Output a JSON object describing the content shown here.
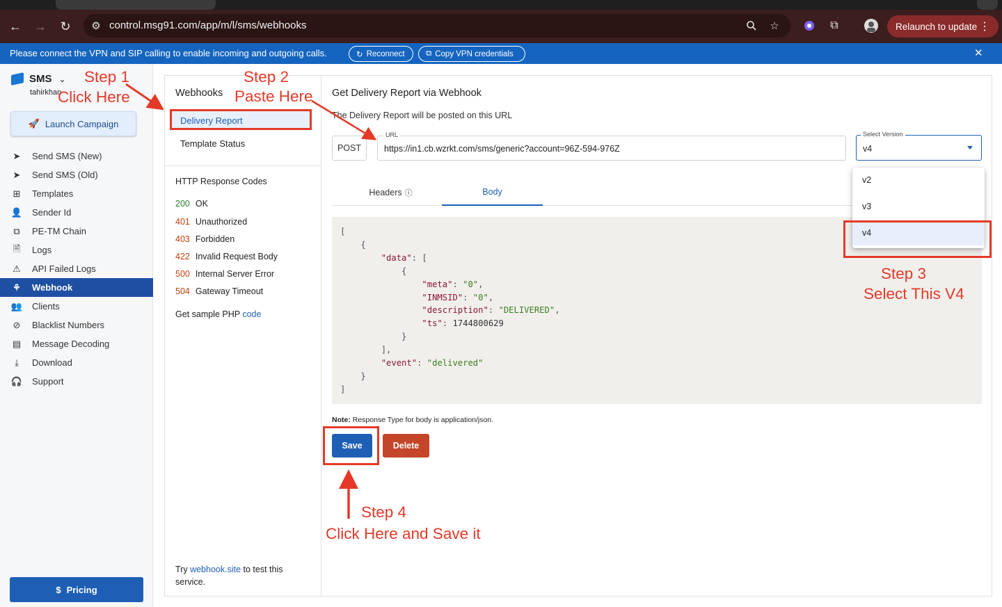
{
  "browser": {
    "url": "control.msg91.com/app/m/l/sms/webhooks",
    "relaunch_label": "Relaunch to update"
  },
  "banner": {
    "message": "Please connect the VPN and SIP calling to enable incoming and outgoing calls.",
    "reconnect_label": "Reconnect",
    "copy_vpn_label": "Copy VPN credentials"
  },
  "sidebar": {
    "app_name": "SMS",
    "username": "tahirkhan",
    "launch_label": "Launch Campaign",
    "items": [
      {
        "label": "Send SMS (New)",
        "icon": "send-icon"
      },
      {
        "label": "Send SMS (Old)",
        "icon": "send-icon"
      },
      {
        "label": "Templates",
        "icon": "grid-icon"
      },
      {
        "label": "Sender Id",
        "icon": "person-icon"
      },
      {
        "label": "PE-TM Chain",
        "icon": "chain-icon"
      },
      {
        "label": "Logs",
        "icon": "document-icon"
      },
      {
        "label": "API Failed Logs",
        "icon": "warning-icon"
      },
      {
        "label": "Webhook",
        "icon": "webhook-icon"
      },
      {
        "label": "Clients",
        "icon": "people-icon"
      },
      {
        "label": "Blacklist Numbers",
        "icon": "block-icon"
      },
      {
        "label": "Message Decoding",
        "icon": "message-icon"
      },
      {
        "label": "Download",
        "icon": "download-icon"
      },
      {
        "label": "Support",
        "icon": "headset-icon"
      }
    ],
    "active_item": "Webhook",
    "pricing_label": "Pricing"
  },
  "webhooks": {
    "title": "Webhooks",
    "items": [
      "Delivery Report",
      "Template Status"
    ],
    "selected": "Delivery Report",
    "codes_title": "HTTP Response Codes",
    "codes": [
      {
        "code": "200",
        "text": "OK"
      },
      {
        "code": "401",
        "text": "Unauthorized"
      },
      {
        "code": "403",
        "text": "Forbidden"
      },
      {
        "code": "422",
        "text": "Invalid Request Body"
      },
      {
        "code": "500",
        "text": "Internal Server Error"
      },
      {
        "code": "504",
        "text": "Gateway Timeout"
      }
    ],
    "sample_prefix": "Get sample PHP ",
    "sample_link": "code",
    "try_prefix": "Try ",
    "try_link": "webhook.site",
    "try_suffix": " to test this service."
  },
  "main": {
    "title": "Get Delivery Report via Webhook",
    "subtitle": "The Delivery Report will be posted on this URL",
    "method": "POST",
    "url_label": "URL",
    "url_value": "https://in1.cb.wzrkt.com/sms/generic?account=96Z-594-976Z",
    "version_label": "Select Version",
    "version_value": "v4",
    "tabs": [
      {
        "label": "Headers"
      },
      {
        "label": "Body"
      }
    ],
    "active_tab": "Body",
    "body": {
      "data_key": "\"data\"",
      "meta_key": "\"meta\"",
      "meta_val": "\"0\"",
      "inmsid_key": "\"INMSID\"",
      "inmsid_val": "\"0\"",
      "desc_key": "\"description\"",
      "desc_val": "\"DELIVERED\"",
      "ts_key": "\"ts\"",
      "ts_val": "1744800629",
      "event_key": "\"event\"",
      "event_val": "\"delivered\""
    },
    "note_bold": "Note:",
    "note_text": " Response Type for body is application/json.",
    "save_label": "Save",
    "delete_label": "Delete"
  },
  "version_dropdown": {
    "options": [
      "v2",
      "v3",
      "v4"
    ],
    "selected": "v4"
  },
  "annotations": {
    "step1_line1": "Step 1",
    "step1_line2": "Click Here",
    "step2_line1": "Step 2",
    "step2_line2": "Paste Here",
    "step3_line1": "Step 3",
    "step3_line2": "Select This V4",
    "step4_line1": "Step 4",
    "step4_line2": "Click Here and Save it",
    "color": "#e53928"
  },
  "colors": {
    "toolbar": "#3c1e1e",
    "banner": "#1565c0",
    "primary": "#1e5fb5",
    "delete": "#c4452a",
    "success": "#2e7d32",
    "error": "#c2410c"
  }
}
